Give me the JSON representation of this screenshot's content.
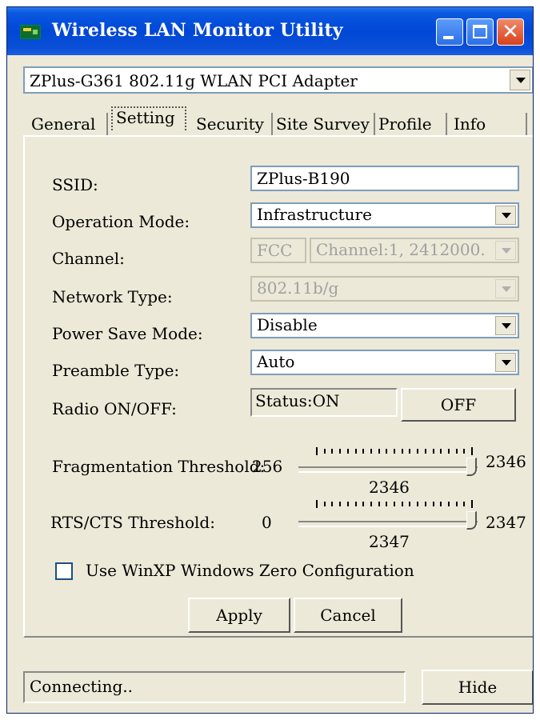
{
  "window": {
    "title": "Wireless LAN Monitor Utility"
  },
  "adapter": {
    "selected": "ZPlus-G361 802.11g WLAN PCI Adapter"
  },
  "tabs": [
    {
      "label": "General"
    },
    {
      "label": "Setting",
      "active": true
    },
    {
      "label": "Security"
    },
    {
      "label": "Site Survey"
    },
    {
      "label": "Profile"
    },
    {
      "label": "Info"
    }
  ],
  "settings": {
    "ssid": {
      "label": "SSID:",
      "value": "ZPlus-B190"
    },
    "operation_mode": {
      "label": "Operation Mode:",
      "value": "Infrastructure"
    },
    "channel": {
      "label": "Channel:",
      "region": "FCC",
      "value": "Channel:1, 2412000."
    },
    "network_type": {
      "label": "Network Type:",
      "value": "802.11b/g"
    },
    "power_save": {
      "label": "Power Save Mode:",
      "value": "Disable"
    },
    "preamble": {
      "label": "Preamble Type:",
      "value": "Auto"
    },
    "radio": {
      "label": "Radio ON/OFF:",
      "status": "Status:ON",
      "button": "OFF"
    },
    "fragmentation": {
      "label": "Fragmentation Threshold:",
      "min": "256",
      "max": "2346",
      "current": "2346"
    },
    "rts": {
      "label": "RTS/CTS Threshold:",
      "min": "0",
      "max": "2347",
      "current": "2347"
    },
    "zero_config": {
      "label": "Use WinXP Windows Zero Configuration",
      "checked": false
    },
    "apply_button": "Apply",
    "cancel_button": "Cancel"
  },
  "statusbar": {
    "text": "Connecting..",
    "hide_button": "Hide"
  },
  "colors": {
    "title_bar": "#0047d6",
    "window_bg": "#ece9d8",
    "close_button": "#d8401c"
  }
}
